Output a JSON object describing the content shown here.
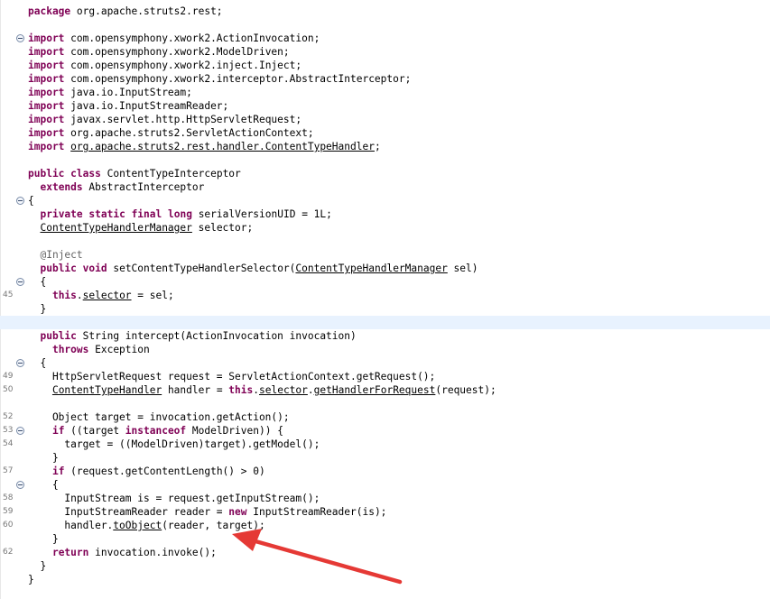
{
  "editor": {
    "lines": [
      {
        "num": "",
        "fold": false,
        "hl": false,
        "tokens": [
          {
            "t": "package",
            "c": "kw"
          },
          {
            "t": " org.apache.struts2.rest;"
          }
        ]
      },
      {
        "num": "",
        "fold": false,
        "hl": false,
        "tokens": []
      },
      {
        "num": "",
        "fold": true,
        "hl": false,
        "tokens": [
          {
            "t": "import",
            "c": "kw"
          },
          {
            "t": " com.opensymphony.xwork2.ActionInvocation;"
          }
        ]
      },
      {
        "num": "",
        "fold": false,
        "hl": false,
        "tokens": [
          {
            "t": "import",
            "c": "kw"
          },
          {
            "t": " com.opensymphony.xwork2.ModelDriven;"
          }
        ]
      },
      {
        "num": "",
        "fold": false,
        "hl": false,
        "tokens": [
          {
            "t": "import",
            "c": "kw"
          },
          {
            "t": " com.opensymphony.xwork2.inject.Inject;"
          }
        ]
      },
      {
        "num": "",
        "fold": false,
        "hl": false,
        "tokens": [
          {
            "t": "import",
            "c": "kw"
          },
          {
            "t": " com.opensymphony.xwork2.interceptor.AbstractInterceptor;"
          }
        ]
      },
      {
        "num": "",
        "fold": false,
        "hl": false,
        "tokens": [
          {
            "t": "import",
            "c": "kw"
          },
          {
            "t": " java.io.InputStream;"
          }
        ]
      },
      {
        "num": "",
        "fold": false,
        "hl": false,
        "tokens": [
          {
            "t": "import",
            "c": "kw"
          },
          {
            "t": " java.io.InputStreamReader;"
          }
        ]
      },
      {
        "num": "",
        "fold": false,
        "hl": false,
        "tokens": [
          {
            "t": "import",
            "c": "kw"
          },
          {
            "t": " javax.servlet.http.HttpServletRequest;"
          }
        ]
      },
      {
        "num": "",
        "fold": false,
        "hl": false,
        "tokens": [
          {
            "t": "import",
            "c": "kw"
          },
          {
            "t": " org.apache.struts2.ServletActionContext;"
          }
        ]
      },
      {
        "num": "",
        "fold": false,
        "hl": false,
        "tokens": [
          {
            "t": "import",
            "c": "kw"
          },
          {
            "t": " "
          },
          {
            "t": "org.apache.struts2.rest.handler.ContentTypeHandler",
            "c": "ul"
          },
          {
            "t": ";"
          }
        ]
      },
      {
        "num": "",
        "fold": false,
        "hl": false,
        "tokens": []
      },
      {
        "num": "",
        "fold": false,
        "hl": false,
        "tokens": [
          {
            "t": "public",
            "c": "kw"
          },
          {
            "t": " "
          },
          {
            "t": "class",
            "c": "kw"
          },
          {
            "t": " ContentTypeInterceptor"
          }
        ]
      },
      {
        "num": "",
        "fold": false,
        "hl": false,
        "tokens": [
          {
            "t": "  "
          },
          {
            "t": "extends",
            "c": "kw"
          },
          {
            "t": " AbstractInterceptor"
          }
        ]
      },
      {
        "num": "",
        "fold": true,
        "hl": false,
        "tokens": [
          {
            "t": "{"
          }
        ]
      },
      {
        "num": "",
        "fold": false,
        "hl": false,
        "tokens": [
          {
            "t": "  "
          },
          {
            "t": "private",
            "c": "kw"
          },
          {
            "t": " "
          },
          {
            "t": "static",
            "c": "kw"
          },
          {
            "t": " "
          },
          {
            "t": "final",
            "c": "kw"
          },
          {
            "t": " "
          },
          {
            "t": "long",
            "c": "kw"
          },
          {
            "t": " serialVersionUID = 1L;"
          }
        ]
      },
      {
        "num": "",
        "fold": false,
        "hl": false,
        "tokens": [
          {
            "t": "  "
          },
          {
            "t": "ContentTypeHandlerManager",
            "c": "ul"
          },
          {
            "t": " selector;"
          }
        ]
      },
      {
        "num": "",
        "fold": false,
        "hl": false,
        "tokens": []
      },
      {
        "num": "",
        "fold": false,
        "hl": false,
        "tokens": [
          {
            "t": "  "
          },
          {
            "t": "@Inject",
            "c": "ann"
          }
        ]
      },
      {
        "num": "",
        "fold": false,
        "hl": false,
        "tokens": [
          {
            "t": "  "
          },
          {
            "t": "public",
            "c": "kw"
          },
          {
            "t": " "
          },
          {
            "t": "void",
            "c": "kw"
          },
          {
            "t": " setContentTypeHandlerSelector("
          },
          {
            "t": "ContentTypeHandlerManager",
            "c": "ul"
          },
          {
            "t": " sel)"
          }
        ]
      },
      {
        "num": "",
        "fold": true,
        "hl": false,
        "tokens": [
          {
            "t": "  {"
          }
        ]
      },
      {
        "num": "45",
        "fold": false,
        "hl": false,
        "tokens": [
          {
            "t": "    "
          },
          {
            "t": "this",
            "c": "kw"
          },
          {
            "t": "."
          },
          {
            "t": "selector",
            "c": "ul"
          },
          {
            "t": " = sel;"
          }
        ]
      },
      {
        "num": "",
        "fold": false,
        "hl": false,
        "tokens": [
          {
            "t": "  }"
          }
        ]
      },
      {
        "num": "",
        "fold": false,
        "hl": true,
        "tokens": []
      },
      {
        "num": "",
        "fold": false,
        "hl": false,
        "tokens": [
          {
            "t": "  "
          },
          {
            "t": "public",
            "c": "kw"
          },
          {
            "t": " String intercept(ActionInvocation invocation)"
          }
        ]
      },
      {
        "num": "",
        "fold": false,
        "hl": false,
        "tokens": [
          {
            "t": "    "
          },
          {
            "t": "throws",
            "c": "kw"
          },
          {
            "t": " Exception"
          }
        ]
      },
      {
        "num": "",
        "fold": true,
        "hl": false,
        "tokens": [
          {
            "t": "  {"
          }
        ]
      },
      {
        "num": "49",
        "fold": false,
        "hl": false,
        "tokens": [
          {
            "t": "    HttpServletRequest request = ServletActionContext.getRequest();"
          }
        ]
      },
      {
        "num": "50",
        "fold": false,
        "hl": false,
        "tokens": [
          {
            "t": "    "
          },
          {
            "t": "ContentTypeHandler",
            "c": "ul"
          },
          {
            "t": " handler = "
          },
          {
            "t": "this",
            "c": "kw"
          },
          {
            "t": "."
          },
          {
            "t": "selector",
            "c": "ul"
          },
          {
            "t": "."
          },
          {
            "t": "getHandlerForRequest",
            "c": "ul"
          },
          {
            "t": "(request);"
          }
        ]
      },
      {
        "num": "",
        "fold": false,
        "hl": false,
        "tokens": []
      },
      {
        "num": "52",
        "fold": false,
        "hl": false,
        "tokens": [
          {
            "t": "    Object target = invocation.getAction();"
          }
        ]
      },
      {
        "num": "53",
        "fold": true,
        "hl": false,
        "tokens": [
          {
            "t": "    "
          },
          {
            "t": "if",
            "c": "kw"
          },
          {
            "t": " ((target "
          },
          {
            "t": "instanceof",
            "c": "kw"
          },
          {
            "t": " ModelDriven)) {"
          }
        ]
      },
      {
        "num": "54",
        "fold": false,
        "hl": false,
        "tokens": [
          {
            "t": "      target = ((ModelDriven)target).getModel();"
          }
        ]
      },
      {
        "num": "",
        "fold": false,
        "hl": false,
        "tokens": [
          {
            "t": "    }"
          }
        ]
      },
      {
        "num": "57",
        "fold": false,
        "hl": false,
        "tokens": [
          {
            "t": "    "
          },
          {
            "t": "if",
            "c": "kw"
          },
          {
            "t": " (request.getContentLength() > 0)"
          }
        ]
      },
      {
        "num": "",
        "fold": true,
        "hl": false,
        "tokens": [
          {
            "t": "    {"
          }
        ]
      },
      {
        "num": "58",
        "fold": false,
        "hl": false,
        "tokens": [
          {
            "t": "      InputStream is = request.getInputStream();"
          }
        ]
      },
      {
        "num": "59",
        "fold": false,
        "hl": false,
        "tokens": [
          {
            "t": "      InputStreamReader reader = "
          },
          {
            "t": "new",
            "c": "kw"
          },
          {
            "t": " InputStreamReader(is);"
          }
        ]
      },
      {
        "num": "60",
        "fold": false,
        "hl": false,
        "tokens": [
          {
            "t": "      handler."
          },
          {
            "t": "toObject",
            "c": "ul"
          },
          {
            "t": "(reader, target);"
          }
        ]
      },
      {
        "num": "",
        "fold": false,
        "hl": false,
        "tokens": [
          {
            "t": "    }"
          }
        ]
      },
      {
        "num": "62",
        "fold": false,
        "hl": false,
        "tokens": [
          {
            "t": "    "
          },
          {
            "t": "return",
            "c": "kw"
          },
          {
            "t": " invocation.invoke();"
          }
        ]
      },
      {
        "num": "",
        "fold": false,
        "hl": false,
        "tokens": [
          {
            "t": "  }"
          }
        ]
      },
      {
        "num": "",
        "fold": false,
        "hl": false,
        "tokens": [
          {
            "t": "}"
          }
        ]
      }
    ]
  },
  "annotation": {
    "arrow_color": "#e53935",
    "icon": "red-arrow-icon"
  }
}
